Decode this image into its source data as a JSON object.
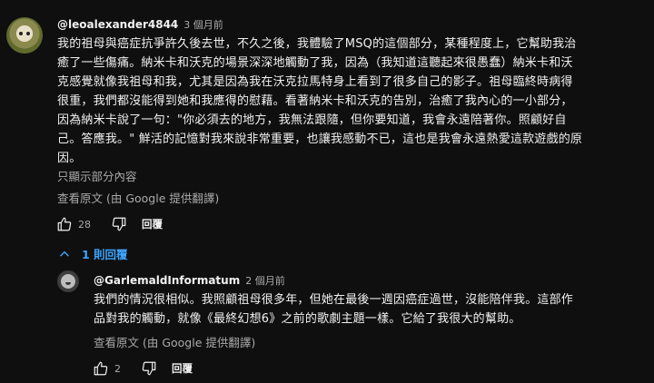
{
  "comment": {
    "author": "@leoalexander4844",
    "time": "3 個月前",
    "text": "我的祖母與癌症抗爭許久後去世，不久之後，我體驗了MSQ的這個部分，某種程度上，它幫助我治\n癒了一些傷痛。納米卡和沃克的場景深深地觸動了我，因為（我知道這聽起來很愚蠢）納米卡和沃\n克感覺就像我祖母和我，尤其是因為我在沃克拉馬特身上看到了很多自己的影子。祖母臨終時病得\n很重，我們都沒能得到她和我應得的慰藉。看著納米卡和沃克的告別，治癒了我內心的一小部分，\n因為納米卡說了一句：\"你必須去的地方，我無法跟隨，但你要知道，我會永遠陪著你。照顧好自\n己。答應我。\" 鮮活的記憶對我來說非常重要，也讓我感動不已，這也是我會永遠熱愛這款遊戲的原\n因。",
    "show_less": "只顯示部分內容",
    "translate": "查看原文 (由 Google 提供翻譯)",
    "like_count": "28",
    "reply_label": "回覆",
    "replies_toggle": "1 則回覆"
  },
  "reply": {
    "author": "@GarlemaldInformatum",
    "time": "2 個月前",
    "text": "我們的情況很相似。我照顧祖母很多年，但她在最後一週因癌症過世，沒能陪伴我。這部作\n品對我的觸動，就像《最終幻想6》之前的歌劇主題一樣。它給了我很大的幫助。",
    "translate": "查看原文 (由 Google 提供翻譯)",
    "like_count": "2",
    "reply_label": "回覆"
  },
  "colors": {
    "background": "#0f0f0f",
    "text": "#f1f1f1",
    "muted": "#aaaaaa",
    "link_blue": "#3ea6ff"
  },
  "icons": [
    "thumbs-up-icon",
    "thumbs-down-icon",
    "chevron-up-icon"
  ]
}
